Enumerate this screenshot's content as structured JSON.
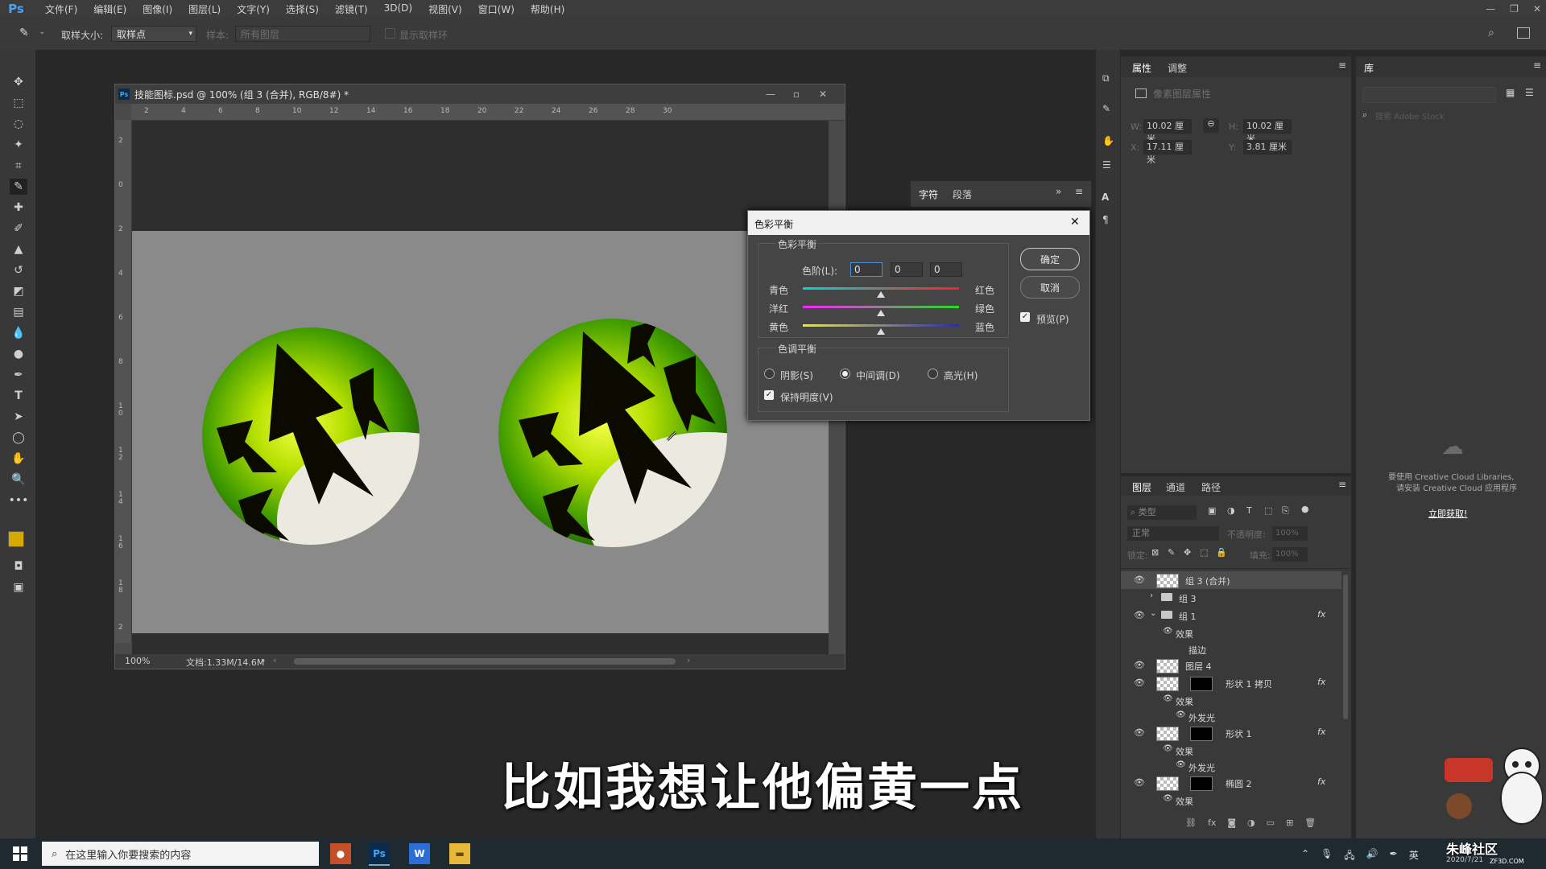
{
  "app": {
    "logo": "Ps"
  },
  "menu": [
    "文件(F)",
    "编辑(E)",
    "图像(I)",
    "图层(L)",
    "文字(Y)",
    "选择(S)",
    "滤镜(T)",
    "3D(D)",
    "视图(V)",
    "窗口(W)",
    "帮助(H)"
  ],
  "options": {
    "sample_size_label": "取样大小:",
    "sample_size_value": "取样点",
    "sample_label": "样本:",
    "sample_value": "所有图层",
    "show_ring": "显示取样环"
  },
  "document": {
    "title": "技能图标.psd @ 100% (组 3 (合并), RGB/8#) *",
    "zoom": "100%",
    "doc_info": "文档:1.33M/14.6M",
    "ruler_top": [
      "2",
      "4",
      "6",
      "8",
      "10",
      "12",
      "14",
      "16",
      "18",
      "20",
      "22",
      "24",
      "26",
      "28",
      "30"
    ],
    "ruler_left": [
      "2",
      "0",
      "2",
      "4",
      "6",
      "8",
      "1 0",
      "1 2",
      "1 4",
      "1 6",
      "1 8",
      "2"
    ]
  },
  "char_panel": {
    "tabs": [
      "字符",
      "段落"
    ]
  },
  "dialog": {
    "title": "色彩平衡",
    "color_balance_group": "色彩平衡",
    "levels_label": "色阶(L):",
    "levels": [
      "0",
      "0",
      "0"
    ],
    "sliders": [
      {
        "left": "青色",
        "right": "红色",
        "value": 0
      },
      {
        "left": "洋红",
        "right": "绿色",
        "value": 0
      },
      {
        "left": "黄色",
        "right": "蓝色",
        "value": 0
      }
    ],
    "tone_group": "色调平衡",
    "tones": [
      "阴影(S)",
      "中间调(D)",
      "高光(H)"
    ],
    "selected_tone": "中间调(D)",
    "preserve_luminosity": "保持明度(V)",
    "ok": "确定",
    "cancel": "取消",
    "preview": "预览(P)"
  },
  "properties": {
    "tabs": [
      "属性",
      "调整"
    ],
    "header": "像素图层属性",
    "w_label": "W:",
    "w": "10.02 厘米",
    "h_label": "H:",
    "h": "10.02 厘米",
    "x_label": "X:",
    "x": "17.11 厘米",
    "y_label": "Y:",
    "y": "3.81 厘米"
  },
  "library": {
    "tab": "库",
    "search_placeholder": "搜索 Adobe Stock",
    "msg1": "要使用 Creative Cloud Libraries,",
    "msg2": "请安装 Creative Cloud 应用程序",
    "link": "立即获取!"
  },
  "layers": {
    "tabs": [
      "图层",
      "通道",
      "路径"
    ],
    "filter": "类型",
    "blend": "正常",
    "opacity_label": "不透明度:",
    "opacity": "100%",
    "lock_label": "锁定:",
    "fill_label": "填充:",
    "fill": "100%",
    "rows": [
      {
        "name": "组 3 (合并)",
        "indent": 0,
        "eye": true,
        "kind": "thumb"
      },
      {
        "name": "组 3",
        "indent": 0,
        "eye": false,
        "kind": "folder"
      },
      {
        "name": "组 1",
        "indent": 0,
        "eye": true,
        "kind": "folder",
        "fx": "fx"
      },
      {
        "name": "效果",
        "indent": 1,
        "eye": false,
        "kind": "effect"
      },
      {
        "name": "描边",
        "indent": 2,
        "eye": false,
        "kind": "sub"
      },
      {
        "name": "图层 4",
        "indent": 0,
        "eye": true,
        "kind": "checker"
      },
      {
        "name": "形状 1 拷贝",
        "indent": 0,
        "eye": true,
        "kind": "shape",
        "fx": "fx"
      },
      {
        "name": "效果",
        "indent": 1,
        "eye": false,
        "kind": "effect"
      },
      {
        "name": "外发光",
        "indent": 2,
        "eye": false,
        "kind": "effect"
      },
      {
        "name": "形状 1",
        "indent": 0,
        "eye": true,
        "kind": "shape",
        "fx": "fx"
      },
      {
        "name": "效果",
        "indent": 1,
        "eye": false,
        "kind": "effect"
      },
      {
        "name": "外发光",
        "indent": 2,
        "eye": false,
        "kind": "effect"
      },
      {
        "name": "椭圆 2",
        "indent": 0,
        "eye": true,
        "kind": "shape",
        "fx": "fx"
      },
      {
        "name": "效果",
        "indent": 1,
        "eye": false,
        "kind": "effect"
      }
    ]
  },
  "subtitle": "比如我想让他偏黄一点",
  "taskbar": {
    "search_placeholder": "在这里输入你要搜索的内容",
    "ime": "英",
    "date": "2020/7/21",
    "watermark": "朱峰社区",
    "watermark_url": "ZF3D.COM"
  },
  "colors": {
    "fg": "#d7a800",
    "bg": "#111111",
    "accent": "#4aa3f0"
  }
}
